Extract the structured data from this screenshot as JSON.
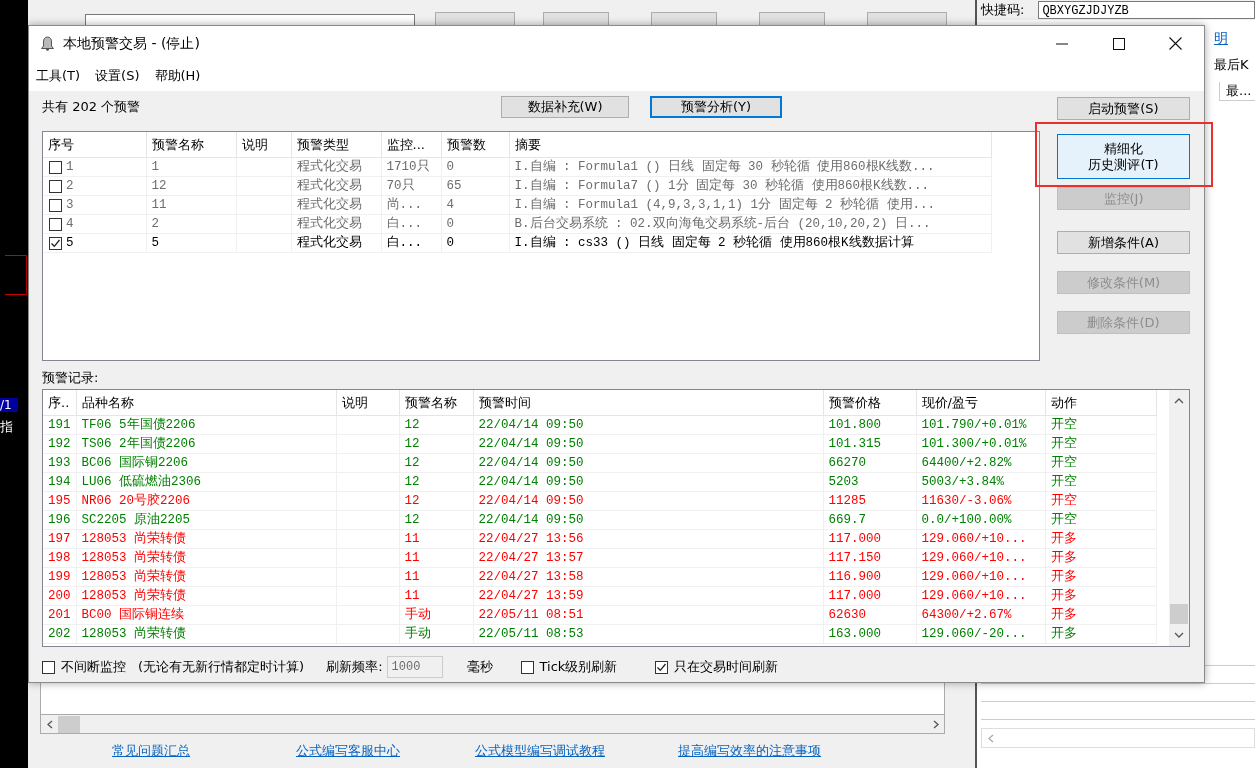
{
  "backdrop": {
    "strip_labels": [
      "/1",
      "指"
    ],
    "links": [
      "常见问题汇总",
      "公式编写客服中心",
      "公式模型编写调试教程",
      "提高编写效率的注意事项"
    ]
  },
  "side_panel": {
    "shortcut_label": "快捷码:",
    "shortcut_value": "QBXYGZJDJYZB",
    "link": "明",
    "note": "最后K",
    "column_header": "最..."
  },
  "window": {
    "title": "本地预警交易 - (停止)"
  },
  "menu": [
    "工具(T)",
    "设置(S)",
    "帮助(H)"
  ],
  "summary": "共有 202 个预警",
  "top_buttons": [
    {
      "label": "数据补充(W)",
      "focused": false
    },
    {
      "label": "预警分析(Y)",
      "focused": true
    }
  ],
  "side_buttons": [
    {
      "label": "启动预警(S)",
      "disabled": false,
      "default": false,
      "annotated": false
    },
    {
      "lines": [
        "精细化",
        "历史测评(T)"
      ],
      "disabled": false,
      "default": true,
      "annotated": true
    },
    {
      "label": "监控(J)",
      "disabled": true,
      "default": false,
      "annotated": false
    },
    {
      "label": "新增条件(A)",
      "disabled": false,
      "default": false,
      "annotated": false
    },
    {
      "label": "修改条件(M)",
      "disabled": true,
      "default": false,
      "annotated": false
    },
    {
      "label": "删除条件(D)",
      "disabled": true,
      "default": false,
      "annotated": false
    }
  ],
  "conditions": {
    "columns": [
      "序号",
      "预警名称",
      "说明",
      "预警类型",
      "监控...",
      "预警数",
      "摘要"
    ],
    "rows": [
      {
        "checked": false,
        "cells": [
          "1",
          "1",
          "",
          "程式化交易",
          "1710只",
          "0",
          "I.自编 : Formula1 () 日线 固定每 30 秒轮循 使用860根K线数..."
        ]
      },
      {
        "checked": false,
        "cells": [
          "2",
          "12",
          "",
          "程式化交易",
          "70只",
          "65",
          "I.自编 : Formula7 () 1分 固定每 30 秒轮循 使用860根K线数..."
        ]
      },
      {
        "checked": false,
        "cells": [
          "3",
          "11",
          "",
          "程式化交易",
          "尚...",
          "4",
          "I.自编 : Formula1 (4,9,3,3,1,1) 1分 固定每 2 秒轮循 使用..."
        ]
      },
      {
        "checked": false,
        "cells": [
          "4",
          "2",
          "",
          "程式化交易",
          "白...",
          "0",
          "B.后台交易系统 : 02.双向海龟交易系统-后台 (20,10,20,2) 日..."
        ]
      },
      {
        "checked": true,
        "cells": [
          "5",
          "5",
          "",
          "程式化交易",
          "白...",
          "0",
          "I.自编 : cs33 () 日线 固定每 2 秒轮循 使用860根K线数据计算"
        ]
      }
    ]
  },
  "records_label": "预警记录:",
  "records": {
    "columns": [
      "序..",
      "品种名称",
      "说明",
      "预警名称",
      "预警时间",
      "预警价格",
      "现价/盈亏",
      "动作"
    ],
    "rows": [
      {
        "color": "#008000",
        "cells": [
          "191",
          "TF06 5年国债2206",
          "",
          "12",
          "22/04/14 09:50",
          "101.800",
          "101.790/+0.01%",
          "开空"
        ]
      },
      {
        "color": "#008000",
        "cells": [
          "192",
          "TS06 2年国债2206",
          "",
          "12",
          "22/04/14 09:50",
          "101.315",
          "101.300/+0.01%",
          "开空"
        ]
      },
      {
        "color": "#008000",
        "cells": [
          "193",
          "BC06 国际铜2206",
          "",
          "12",
          "22/04/14 09:50",
          "66270",
          "64400/+2.82%",
          "开空"
        ]
      },
      {
        "color": "#008000",
        "cells": [
          "194",
          "LU06 低硫燃油2306",
          "",
          "12",
          "22/04/14 09:50",
          "5203",
          "5003/+3.84%",
          "开空"
        ]
      },
      {
        "color": "#ff0000",
        "cells": [
          "195",
          "NR06 20号胶2206",
          "",
          "12",
          "22/04/14 09:50",
          "11285",
          "11630/-3.06%",
          "开空"
        ]
      },
      {
        "color": "#008000",
        "cells": [
          "196",
          "SC2205 原油2205",
          "",
          "12",
          "22/04/14 09:50",
          "669.7",
          "0.0/+100.00%",
          "开空"
        ]
      },
      {
        "color": "#ff0000",
        "cells": [
          "197",
          "128053 尚荣转债",
          "",
          "11",
          "22/04/27 13:56",
          "117.000",
          "129.060/+10...",
          "开多"
        ]
      },
      {
        "color": "#ff0000",
        "cells": [
          "198",
          "128053 尚荣转债",
          "",
          "11",
          "22/04/27 13:57",
          "117.150",
          "129.060/+10...",
          "开多"
        ]
      },
      {
        "color": "#ff0000",
        "cells": [
          "199",
          "128053 尚荣转债",
          "",
          "11",
          "22/04/27 13:58",
          "116.900",
          "129.060/+10...",
          "开多"
        ]
      },
      {
        "color": "#ff0000",
        "cells": [
          "200",
          "128053 尚荣转债",
          "",
          "11",
          "22/04/27 13:59",
          "117.000",
          "129.060/+10...",
          "开多"
        ]
      },
      {
        "color": "#ff0000",
        "cells": [
          "201",
          "BC00 国际铜连续",
          "",
          "手动",
          "22/05/11 08:51",
          "62630",
          "64300/+2.67%",
          "开多"
        ]
      },
      {
        "color": "#008000",
        "cells": [
          "202",
          "128053 尚荣转债",
          "",
          "手动",
          "22/05/11 08:53",
          "163.000",
          "129.060/-20...",
          "开多"
        ]
      }
    ]
  },
  "options": [
    {
      "kind": "checkbox",
      "label": "不间断监控",
      "checked": false
    },
    {
      "kind": "text",
      "label": "(无论有无新行情都定时计算)"
    },
    {
      "kind": "text",
      "label": "刷新频率:"
    },
    {
      "kind": "field",
      "value": "1000",
      "disabled": true
    },
    {
      "kind": "text",
      "label": "毫秒"
    },
    {
      "kind": "checkbox",
      "label": "Tick级别刷新",
      "checked": false
    },
    {
      "kind": "checkbox",
      "label": "只在交易时间刷新",
      "checked": true
    }
  ]
}
